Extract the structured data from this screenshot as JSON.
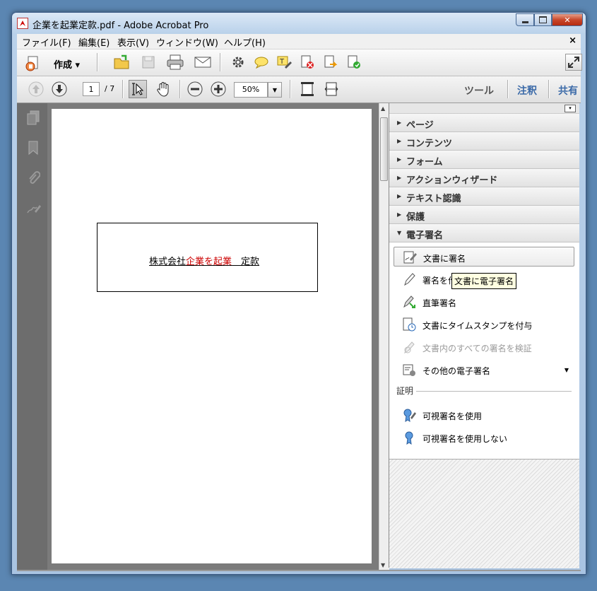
{
  "window": {
    "title": "企業を起業定款.pdf - Adobe Acrobat Pro"
  },
  "menubar": {
    "items": [
      "ファイル(F)",
      "編集(E)",
      "表示(V)",
      "ウィンドウ(W)",
      "ヘルプ(H)"
    ],
    "close": "×"
  },
  "toolbar1": {
    "create_label": "作成 ▾"
  },
  "toolbar2": {
    "current_page": "1",
    "total_pages": "/ 7",
    "zoom": "50%",
    "tools": "ツール",
    "comment": "注釈",
    "share": "共有"
  },
  "document": {
    "text_prefix": "株式会社",
    "text_red": "企業を起業",
    "text_suffix": "　定款"
  },
  "panel": {
    "sections": [
      "ページ",
      "コンテンツ",
      "フォーム",
      "アクションウィザード",
      "テキスト認識",
      "保護",
      "電子署名"
    ],
    "signature_items": [
      "文書に署名",
      "署名を作",
      "直筆署名",
      "文書にタイムスタンプを付与",
      "文書内のすべての署名を検証",
      "その他の電子署名"
    ],
    "certification_label": "証明",
    "certification_items": [
      "可視署名を使用",
      "可視署名を使用しない"
    ]
  },
  "tooltip": "文書に電子署名",
  "colors": {
    "accent_blue": "#3b6aa8",
    "doc_red": "#cc0000"
  }
}
